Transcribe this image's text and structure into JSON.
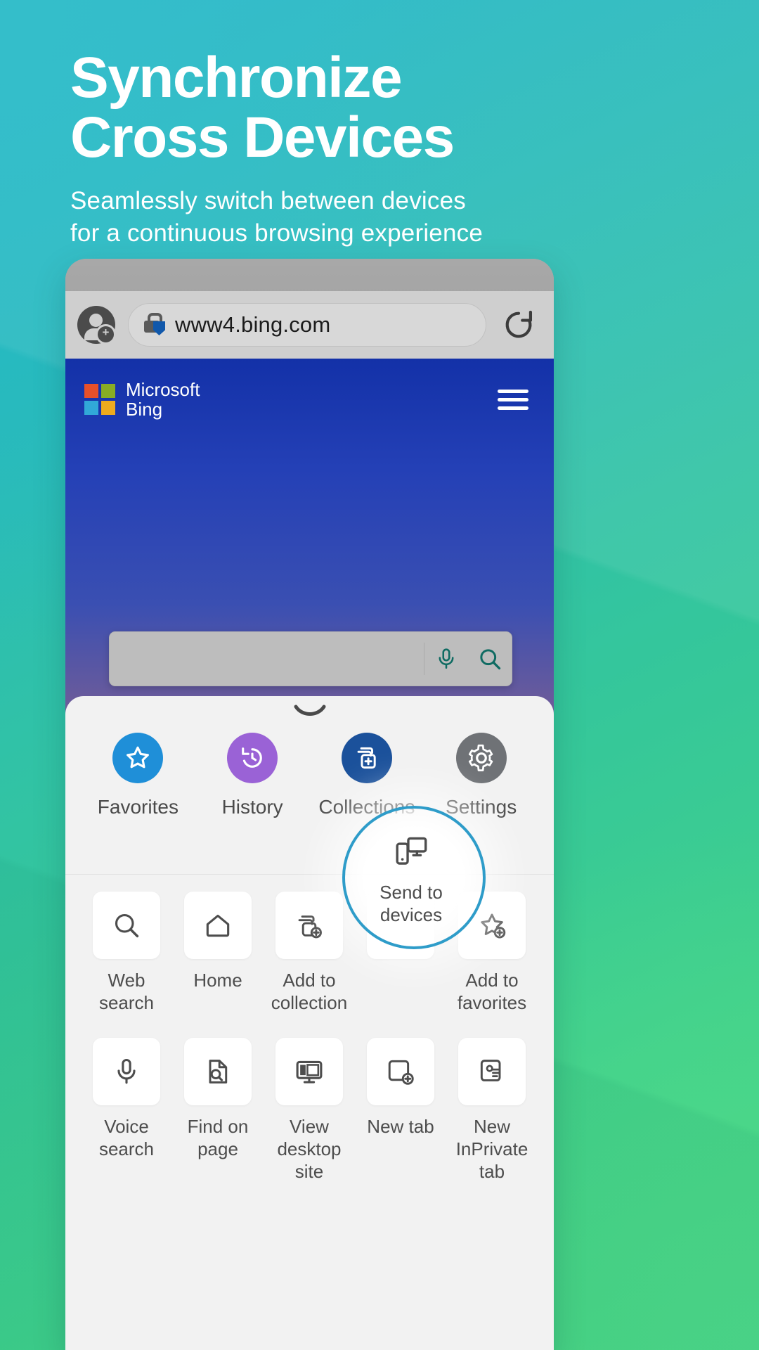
{
  "hero": {
    "title_line1": "Synchronize",
    "title_line2": "Cross Devices",
    "subtitle_line1": "Seamlessly switch between devices",
    "subtitle_line2": "for a continuous browsing experience"
  },
  "colors": {
    "bg_start": "#22b4c9",
    "bg_end": "#4ad97f",
    "favorites": "#1f8fd8",
    "history": "#9a62d6",
    "collections": "#1b519b",
    "settings": "#6f7276",
    "highlight_ring": "#2e9cc9",
    "lock_shield": "#1158ab"
  },
  "browser": {
    "avatar_icon": "account-add-icon",
    "lock_icon": "lock-shield-icon",
    "url": "www4.bing.com",
    "reload_icon": "reload-icon"
  },
  "webpage": {
    "brand_line1": "Microsoft",
    "brand_line2": "Bing",
    "logo_icon": "microsoft-squares-icon",
    "logo_colors": [
      "#e8502a",
      "#88ad24",
      "#31a8d8",
      "#eeab1e"
    ],
    "menu_icon": "hamburger-icon",
    "search_placeholder": "",
    "mic_icon": "microphone-icon",
    "search_icon": "search-icon",
    "accent": "#0f6b62"
  },
  "sheet": {
    "grabber_icon": "chevron-down-icon",
    "quick_actions": [
      {
        "label": "Favorites",
        "icon": "star-icon",
        "color": "#1f8fd8"
      },
      {
        "label": "History",
        "icon": "history-icon",
        "color": "#9a62d6"
      },
      {
        "label": "Collections",
        "icon": "collections-icon",
        "color": "#1b519b"
      },
      {
        "label": "Settings",
        "icon": "gear-icon",
        "color": "#6f7276"
      }
    ],
    "grid_items": [
      {
        "label": "Web\nsearch",
        "icon": "search-icon",
        "highlighted": false
      },
      {
        "label": "Home",
        "icon": "home-icon",
        "highlighted": false
      },
      {
        "label": "Add to\ncollection",
        "icon": "add-collection-icon",
        "highlighted": false
      },
      {
        "label": "Send to\ndevices",
        "icon": "send-to-devices-icon",
        "highlighted": true
      },
      {
        "label": "Add to\nfavorites",
        "icon": "add-favorite-icon",
        "highlighted": false
      },
      {
        "label": "Voice\nsearch",
        "icon": "microphone-icon",
        "highlighted": false
      },
      {
        "label": "Find on\npage",
        "icon": "find-on-page-icon",
        "highlighted": false
      },
      {
        "label": "View\ndesktop\nsite",
        "icon": "desktop-site-icon",
        "highlighted": false
      },
      {
        "label": "New tab",
        "icon": "new-tab-icon",
        "highlighted": false
      },
      {
        "label": "New\nInPrivate\ntab",
        "icon": "inprivate-tab-icon",
        "highlighted": false
      }
    ]
  }
}
